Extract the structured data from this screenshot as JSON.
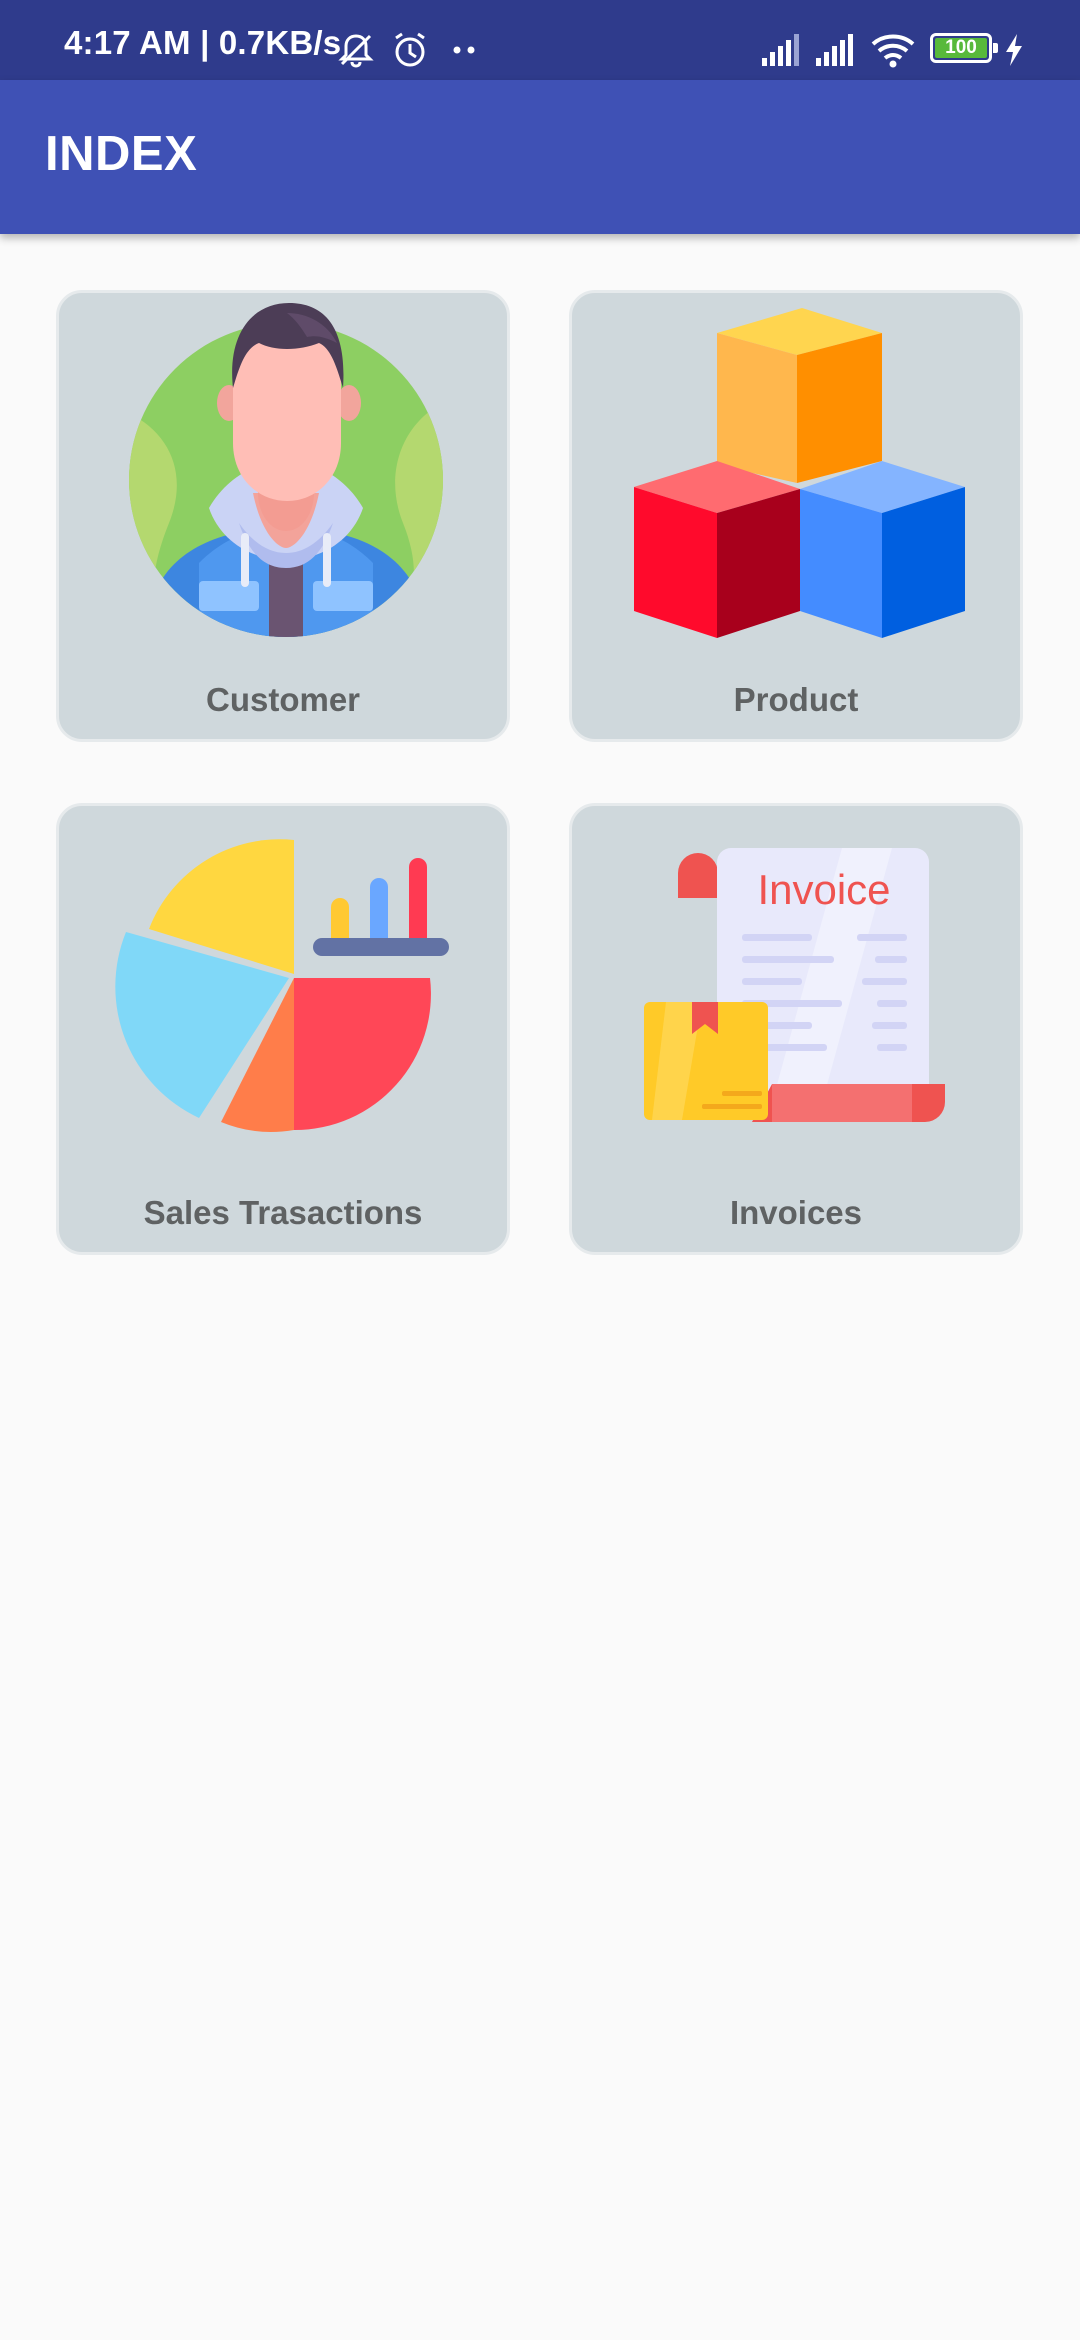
{
  "status_bar": {
    "time": "4:17 AM | 0.7KB/s",
    "battery": "100",
    "icons": [
      "mute-bell-icon",
      "alarm-icon",
      "more-dots-icon",
      "signal-icon",
      "signal-icon",
      "wifi-icon",
      "battery-icon",
      "charging-icon"
    ]
  },
  "app_bar": {
    "title": "INDEX"
  },
  "tiles": [
    {
      "label": "Customer",
      "icon": "customer-avatar-icon"
    },
    {
      "label": "Product",
      "icon": "product-cubes-icon"
    },
    {
      "label": "Sales Trasactions",
      "icon": "sales-chart-icon"
    },
    {
      "label": "Invoices",
      "icon": "invoice-icon",
      "icon_text": "Invoice"
    }
  ],
  "colors": {
    "status_bar": "#2f3b8c",
    "app_bar": "#3f51b5",
    "tile_background": "#cfd8dc",
    "page_background": "#fafafa"
  }
}
